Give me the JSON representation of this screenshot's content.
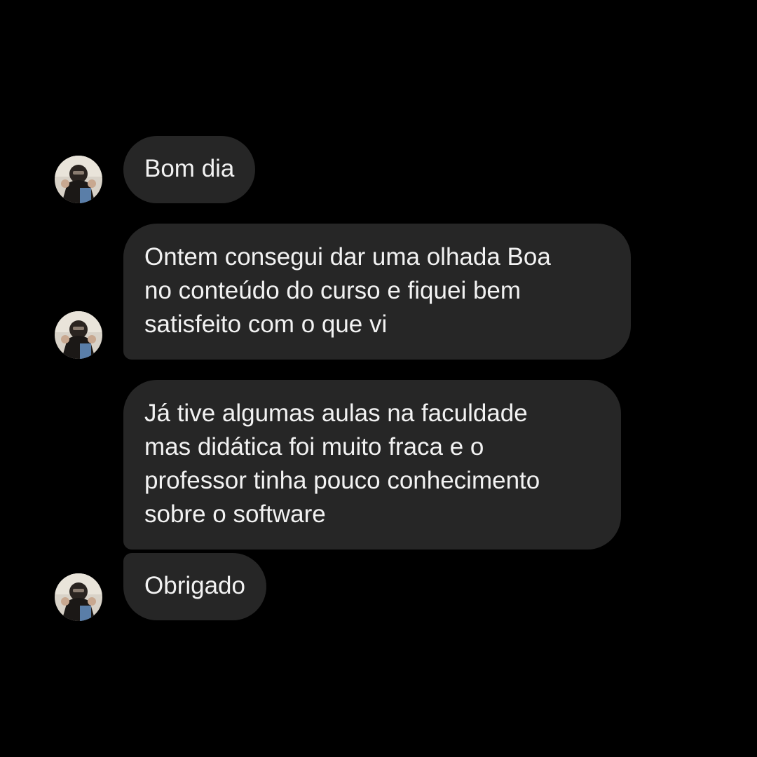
{
  "conversation": {
    "messages": [
      {
        "lines": [
          "Bom dia"
        ]
      },
      {
        "lines": [
          "Ontem consegui dar uma olhada Boa",
          "no conteúdo do curso e fiquei bem",
          "satisfeito com o que vi"
        ]
      },
      {
        "lines": [
          "Já tive algumas aulas na faculdade",
          "mas didática foi muito fraca e o",
          "professor tinha pouco conhecimento",
          "sobre o software"
        ]
      },
      {
        "lines": [
          "Obrigado"
        ]
      }
    ]
  },
  "colors": {
    "background": "#000000",
    "bubble": "#262626",
    "text": "#f2f2f2"
  }
}
